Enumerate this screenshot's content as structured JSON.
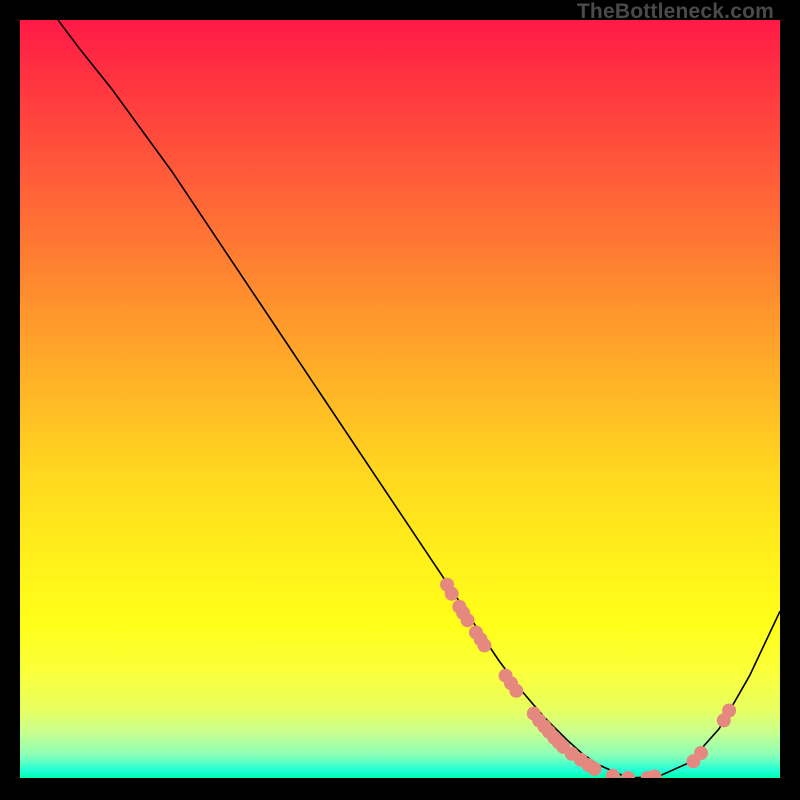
{
  "watermark": "TheBottleneck.com",
  "chart_data": {
    "type": "line",
    "title": "",
    "xlabel": "",
    "ylabel": "",
    "xlim": [
      0,
      100
    ],
    "ylim": [
      0,
      100
    ],
    "grid": false,
    "series": [
      {
        "name": "curve",
        "color": "#000000",
        "x": [
          5,
          8,
          12,
          16,
          20,
          24,
          28,
          32,
          36,
          40,
          44,
          48,
          52,
          56,
          60,
          63,
          66,
          69,
          72,
          74,
          76,
          80,
          84,
          88,
          92,
          96,
          100
        ],
        "y": [
          100,
          96,
          91,
          85.5,
          80,
          74,
          68,
          62,
          56,
          50,
          44,
          38,
          32,
          26,
          20,
          15.5,
          11.5,
          8,
          5,
          3.2,
          1.8,
          0.0,
          0.2,
          2.0,
          6.5,
          13.5,
          22
        ]
      }
    ],
    "points": {
      "name": "dots",
      "color": "#e5887f",
      "radius": 7,
      "xy": [
        [
          56.2,
          25.5
        ],
        [
          56.8,
          24.3
        ],
        [
          57.8,
          22.6
        ],
        [
          58.3,
          21.8
        ],
        [
          58.9,
          20.8
        ],
        [
          60.0,
          19.2
        ],
        [
          60.6,
          18.3
        ],
        [
          61.1,
          17.5
        ],
        [
          63.9,
          13.5
        ],
        [
          64.6,
          12.5
        ],
        [
          65.3,
          11.5
        ],
        [
          67.6,
          8.5
        ],
        [
          68.3,
          7.6
        ],
        [
          69.0,
          6.8
        ],
        [
          69.6,
          6.1
        ],
        [
          70.3,
          5.3
        ],
        [
          70.9,
          4.7
        ],
        [
          71.5,
          4.1
        ],
        [
          72.6,
          3.2
        ],
        [
          73.8,
          2.4
        ],
        [
          74.8,
          1.7
        ],
        [
          75.6,
          1.2
        ],
        [
          78.0,
          0.3
        ],
        [
          80.0,
          0.0
        ],
        [
          82.6,
          0.0
        ],
        [
          83.5,
          0.2
        ],
        [
          88.6,
          2.2
        ],
        [
          89.6,
          3.3
        ],
        [
          92.6,
          7.6
        ],
        [
          93.3,
          8.9
        ]
      ]
    }
  }
}
